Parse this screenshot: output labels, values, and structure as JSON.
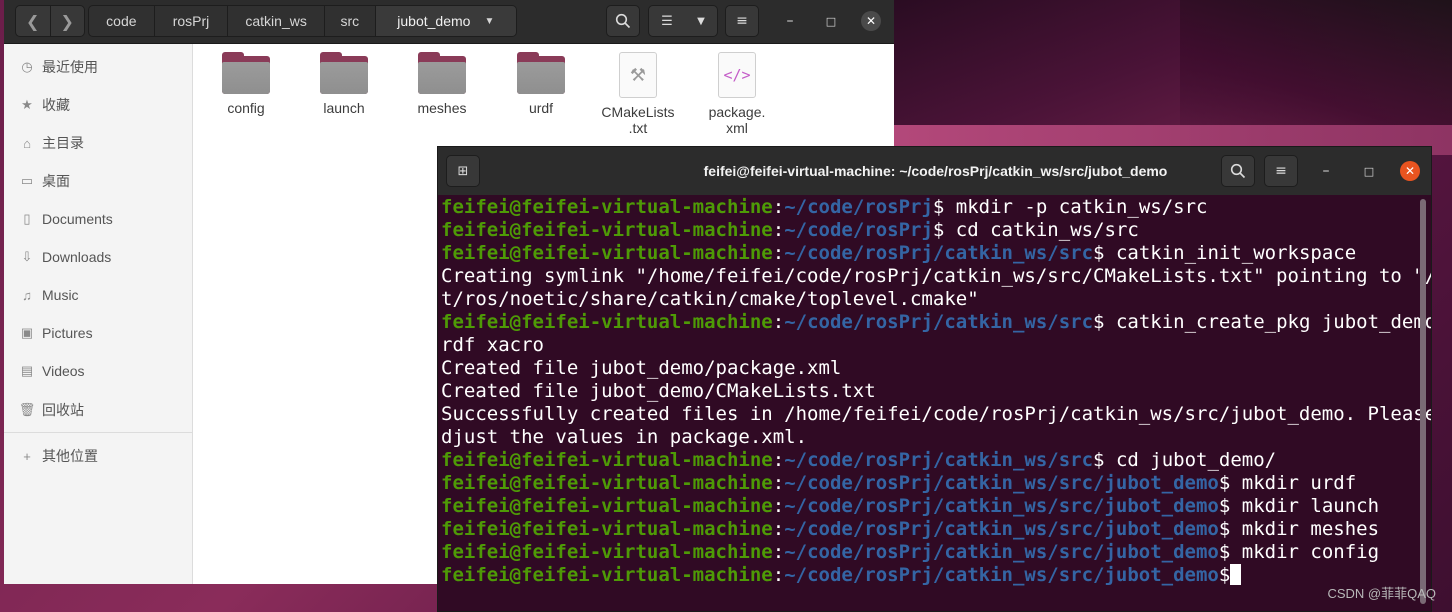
{
  "files": {
    "breadcrumbs": [
      "code",
      "rosPrj",
      "catkin_ws",
      "src",
      "jubot_demo"
    ],
    "sidebar": [
      {
        "icon": "clock-icon",
        "label": "最近使用"
      },
      {
        "icon": "star-icon",
        "label": "收藏"
      },
      {
        "icon": "home-icon",
        "label": "主目录"
      },
      {
        "icon": "desktop-icon",
        "label": "桌面"
      },
      {
        "icon": "document-icon",
        "label": "Documents"
      },
      {
        "icon": "download-icon",
        "label": "Downloads"
      },
      {
        "icon": "music-icon",
        "label": "Music"
      },
      {
        "icon": "pictures-icon",
        "label": "Pictures"
      },
      {
        "icon": "videos-icon",
        "label": "Videos"
      },
      {
        "icon": "trash-icon",
        "label": "回收站"
      },
      {
        "icon": "plus-icon",
        "label": "其他位置"
      }
    ],
    "items": [
      {
        "type": "folder",
        "name": "config"
      },
      {
        "type": "folder",
        "name": "launch"
      },
      {
        "type": "folder",
        "name": "meshes"
      },
      {
        "type": "folder",
        "name": "urdf"
      },
      {
        "type": "text",
        "name1": "CMakeLists",
        "name2": ".txt"
      },
      {
        "type": "xml",
        "name1": "package.",
        "name2": "xml"
      }
    ]
  },
  "terminal": {
    "title": "feifei@feifei-virtual-machine: ~/code/rosPrj/catkin_ws/src/jubot_demo",
    "prompt_user": "feifei@feifei-virtual-machine",
    "lines": [
      {
        "kind": "prompt",
        "path": "~/code/rosPrj",
        "cmd": " mkdir -p catkin_ws/src"
      },
      {
        "kind": "prompt",
        "path": "~/code/rosPrj",
        "cmd": " cd catkin_ws/src"
      },
      {
        "kind": "prompt",
        "path": "~/code/rosPrj/catkin_ws/src",
        "cmd": " catkin_init_workspace"
      },
      {
        "kind": "out",
        "text": "Creating symlink \"/home/feifei/code/rosPrj/catkin_ws/src/CMakeLists.txt\" pointing to \"/op"
      },
      {
        "kind": "out",
        "text": "t/ros/noetic/share/catkin/cmake/toplevel.cmake\""
      },
      {
        "kind": "prompt",
        "path": "~/code/rosPrj/catkin_ws/src",
        "cmd": " catkin_create_pkg jubot_demo u"
      },
      {
        "kind": "out",
        "text": "rdf xacro"
      },
      {
        "kind": "out",
        "text": "Created file jubot_demo/package.xml"
      },
      {
        "kind": "out",
        "text": "Created file jubot_demo/CMakeLists.txt"
      },
      {
        "kind": "out",
        "text": "Successfully created files in /home/feifei/code/rosPrj/catkin_ws/src/jubot_demo. Please a"
      },
      {
        "kind": "out",
        "text": "djust the values in package.xml."
      },
      {
        "kind": "prompt",
        "path": "~/code/rosPrj/catkin_ws/src",
        "cmd": " cd jubot_demo/"
      },
      {
        "kind": "prompt",
        "path": "~/code/rosPrj/catkin_ws/src/jubot_demo",
        "cmd": " mkdir urdf"
      },
      {
        "kind": "prompt",
        "path": "~/code/rosPrj/catkin_ws/src/jubot_demo",
        "cmd": " mkdir launch"
      },
      {
        "kind": "prompt",
        "path": "~/code/rosPrj/catkin_ws/src/jubot_demo",
        "cmd": " mkdir meshes"
      },
      {
        "kind": "prompt",
        "path": "~/code/rosPrj/catkin_ws/src/jubot_demo",
        "cmd": " mkdir config"
      },
      {
        "kind": "prompt",
        "path": "~/code/rosPrj/catkin_ws/src/jubot_demo",
        "cmd": "",
        "cursor": true
      }
    ]
  },
  "watermark": "CSDN @菲菲QAQ",
  "colors": {
    "terminal_bg": "#300a24",
    "prompt_user": "#4e9a06",
    "prompt_path": "#3465a4",
    "accent_close": "#e95420"
  }
}
